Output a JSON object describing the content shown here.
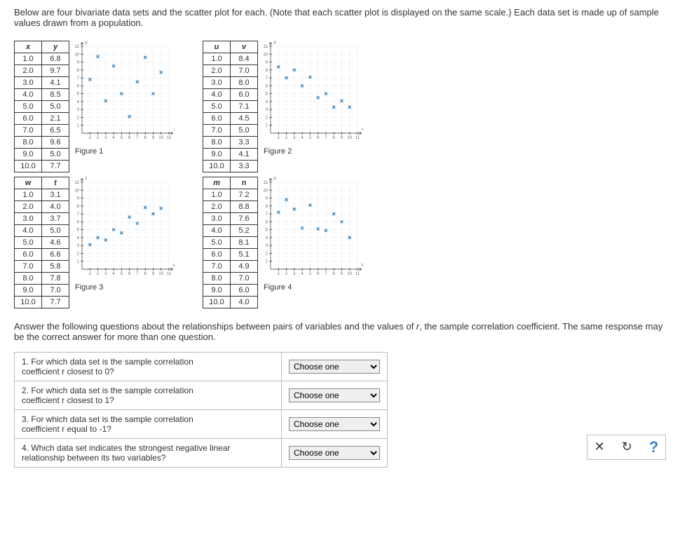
{
  "intro_line1": "Below are four bivariate data sets and the scatter plot for each. (Note that each scatter plot is displayed on the same scale.) Each data set is made up of sample",
  "intro_line2": "values drawn from a population.",
  "questions_intro_a": "Answer the following questions about the relationships between pairs of variables and the values of ",
  "questions_intro_r": "r",
  "questions_intro_b": ", the sample correlation coefficient. The same response may",
  "questions_intro_c": "be the correct answer for more than one question.",
  "select_placeholder": "Choose one",
  "toolbar": {
    "clear": "✕",
    "reset": "↻",
    "help": "?"
  },
  "q1a": "1. For which data set is the sample correlation",
  "q1b": "coefficient r closest to 0?",
  "q2a": "2. For which data set is the sample correlation",
  "q2b": "coefficient r closest to 1?",
  "q3a": "3. For which data set is the sample correlation",
  "q3b": "coefficient r equal to -1?",
  "q4a": "4. Which data set indicates the strongest negative linear",
  "q4b": "relationship between its two variables?",
  "panels": {
    "fig1": {
      "label": "Figure 1",
      "hx": "x",
      "hy": "y",
      "rows": [
        [
          "1.0",
          "6.8"
        ],
        [
          "2.0",
          "9.7"
        ],
        [
          "3.0",
          "4.1"
        ],
        [
          "4.0",
          "8.5"
        ],
        [
          "5.0",
          "5.0"
        ],
        [
          "6.0",
          "2.1"
        ],
        [
          "7.0",
          "6.5"
        ],
        [
          "8.0",
          "9.6"
        ],
        [
          "9.0",
          "5.0"
        ],
        [
          "10.0",
          "7.7"
        ]
      ]
    },
    "fig2": {
      "label": "Figure 2",
      "hx": "u",
      "hy": "v",
      "rows": [
        [
          "1.0",
          "8.4"
        ],
        [
          "2.0",
          "7.0"
        ],
        [
          "3.0",
          "8.0"
        ],
        [
          "4.0",
          "6.0"
        ],
        [
          "5.0",
          "7.1"
        ],
        [
          "6.0",
          "4.5"
        ],
        [
          "7.0",
          "5.0"
        ],
        [
          "8.0",
          "3.3"
        ],
        [
          "9.0",
          "4.1"
        ],
        [
          "10.0",
          "3.3"
        ]
      ]
    },
    "fig3": {
      "label": "Figure 3",
      "hx": "w",
      "hy": "t",
      "rows": [
        [
          "1.0",
          "3.1"
        ],
        [
          "2.0",
          "4.0"
        ],
        [
          "3.0",
          "3.7"
        ],
        [
          "4.0",
          "5.0"
        ],
        [
          "5.0",
          "4.6"
        ],
        [
          "6.0",
          "6.6"
        ],
        [
          "7.0",
          "5.8"
        ],
        [
          "8.0",
          "7.8"
        ],
        [
          "9.0",
          "7.0"
        ],
        [
          "10.0",
          "7.7"
        ]
      ]
    },
    "fig4": {
      "label": "Figure 4",
      "hx": "m",
      "hy": "n",
      "rows": [
        [
          "1.0",
          "7.2"
        ],
        [
          "2.0",
          "8.8"
        ],
        [
          "3.0",
          "7.6"
        ],
        [
          "4.0",
          "5.2"
        ],
        [
          "5.0",
          "8.1"
        ],
        [
          "6.0",
          "5.1"
        ],
        [
          "7.0",
          "4.9"
        ],
        [
          "8.0",
          "7.0"
        ],
        [
          "9.0",
          "6.0"
        ],
        [
          "10.0",
          "4.0"
        ]
      ]
    }
  },
  "chart_data": [
    {
      "type": "scatter",
      "title": "Figure 1",
      "xlabel": "x",
      "ylabel": "y",
      "xlim": [
        0,
        11
      ],
      "ylim": [
        0,
        11
      ],
      "x": [
        1,
        2,
        3,
        4,
        5,
        6,
        7,
        8,
        9,
        10
      ],
      "y": [
        6.8,
        9.7,
        4.1,
        8.5,
        5.0,
        2.1,
        6.5,
        9.6,
        5.0,
        7.7
      ]
    },
    {
      "type": "scatter",
      "title": "Figure 2",
      "xlabel": "u",
      "ylabel": "v",
      "xlim": [
        0,
        11
      ],
      "ylim": [
        0,
        11
      ],
      "x": [
        1,
        2,
        3,
        4,
        5,
        6,
        7,
        8,
        9,
        10
      ],
      "y": [
        8.4,
        7.0,
        8.0,
        6.0,
        7.1,
        4.5,
        5.0,
        3.3,
        4.1,
        3.3
      ]
    },
    {
      "type": "scatter",
      "title": "Figure 3",
      "xlabel": "w",
      "ylabel": "t",
      "xlim": [
        0,
        11
      ],
      "ylim": [
        0,
        11
      ],
      "x": [
        1,
        2,
        3,
        4,
        5,
        6,
        7,
        8,
        9,
        10
      ],
      "y": [
        3.1,
        4.0,
        3.7,
        5.0,
        4.6,
        6.6,
        5.8,
        7.8,
        7.0,
        7.7
      ]
    },
    {
      "type": "scatter",
      "title": "Figure 4",
      "xlabel": "m",
      "ylabel": "n",
      "xlim": [
        0,
        11
      ],
      "ylim": [
        0,
        11
      ],
      "x": [
        1,
        2,
        3,
        4,
        5,
        6,
        7,
        8,
        9,
        10
      ],
      "y": [
        7.2,
        8.8,
        7.6,
        5.2,
        8.1,
        5.1,
        4.9,
        7.0,
        6.0,
        4.0
      ]
    }
  ]
}
